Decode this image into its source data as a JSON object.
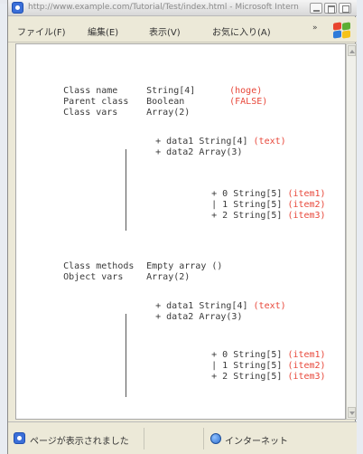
{
  "window": {
    "title": "http://www.example.com/Tutorial/Test/index.html - Microsoft Internet Explorer"
  },
  "menu": [
    {
      "label": "ファイル(F)"
    },
    {
      "label": "編集(E)"
    },
    {
      "label": "表示(V)"
    },
    {
      "label": "お気に入り(A)"
    }
  ],
  "menu_more": "»",
  "dump": {
    "header": [
      {
        "key": "Class name",
        "value": "String[4]",
        "note": "(hoge)"
      },
      {
        "key": "Parent class",
        "value": "Boolean",
        "note": "(FALSE)"
      },
      {
        "key": "Class vars",
        "value": "Array(2)",
        "note": ""
      }
    ],
    "class_vars_tree": [
      {
        "prefix": "+ data1",
        "value": "String[4]",
        "note": "(text)"
      },
      {
        "prefix": "+ data2",
        "value": "Array(3)",
        "note": ""
      }
    ],
    "class_vars_items": [
      {
        "prefix": "+ 0",
        "value": "String[5]",
        "note": "(item1)"
      },
      {
        "prefix": "| 1",
        "value": "String[5]",
        "note": "(item2)"
      },
      {
        "prefix": "+ 2",
        "value": "String[5]",
        "note": "(item3)"
      }
    ],
    "methods": [
      {
        "key": "Class methods",
        "value": "Empty array ()"
      },
      {
        "key": "Object vars",
        "value": "Array(2)"
      }
    ],
    "object_vars_tree": [
      {
        "prefix": "+ data1",
        "value": "String[4]",
        "note": "(text)"
      },
      {
        "prefix": "+ data2",
        "value": "Array(3)",
        "note": ""
      }
    ],
    "object_vars_items": [
      {
        "prefix": "+ 0",
        "value": "String[5]",
        "note": "(item1)"
      },
      {
        "prefix": "| 1",
        "value": "String[5]",
        "note": "(item2)"
      },
      {
        "prefix": "+ 2",
        "value": "String[5]",
        "note": "(item3)"
      }
    ]
  },
  "status": {
    "text": "ページが表示されました",
    "zone": "インターネット"
  },
  "colors": {
    "note_red": "#e8473a",
    "text": "#3a3a3a"
  }
}
